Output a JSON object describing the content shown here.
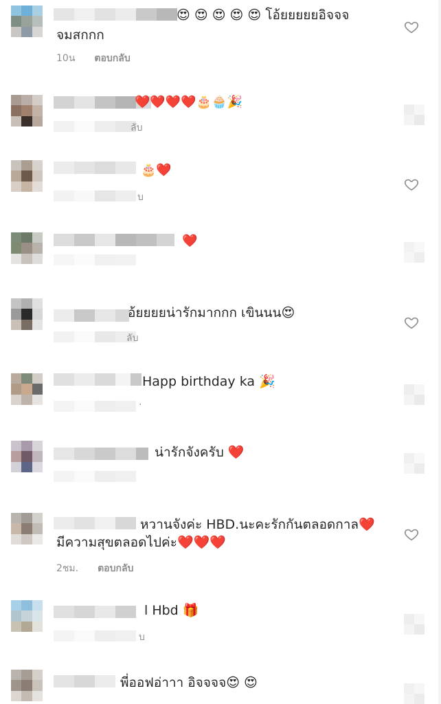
{
  "comments": [
    {
      "text": "😍 😍 😍 😍 😍 โอ้ยยยยยอิจจจ",
      "text2": "จมสกกก",
      "time": "10น",
      "reply": "ตอบกลับ",
      "like_icon": "heart-outline-icon"
    },
    {
      "text": "❤️❤️❤️❤️🎂🧁🎉",
      "reply_fragment": "ลับ"
    },
    {
      "text": "🎂❤️",
      "reply_fragment": "บ",
      "like_icon": "heart-outline-icon"
    },
    {
      "text": "❤️"
    },
    {
      "text": "อ้ยยยยน่ารักมากกก เขินนน😍",
      "reply_fragment": "ลับ",
      "like_icon": "heart-outline-icon"
    },
    {
      "text": "Happ birthday ka 🎉",
      "reply_fragment": "."
    },
    {
      "text": "น่ารักจังครับ ❤️"
    },
    {
      "text": "หวานจังค่ะ HBD.นะคะรักกันตลอดกาล❤️",
      "text2": "มีความสุขตลอดไปค่ะ❤️❤️❤️",
      "time": "2ชม.",
      "reply": "ตอบกลับ",
      "like_icon": "heart-outline-icon"
    },
    {
      "text": "l Hbd 🎁",
      "reply_fragment": "บ"
    },
    {
      "text": "พี่ออฟอ่าาา อิจจจจ😍 😍"
    }
  ]
}
